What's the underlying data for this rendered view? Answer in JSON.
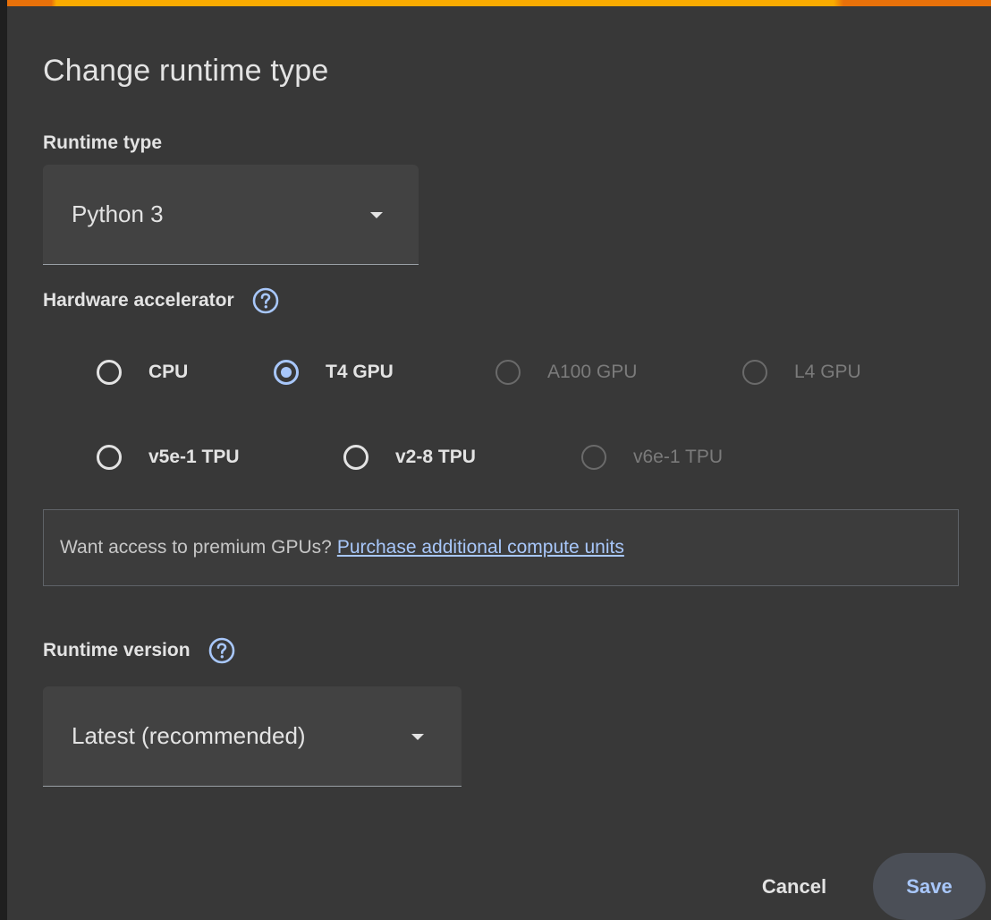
{
  "dialog": {
    "title": "Change runtime type",
    "accent_colors": [
      "#e8710a",
      "#f9ab00"
    ]
  },
  "runtime_type": {
    "label": "Runtime type",
    "selected": "Python 3"
  },
  "hardware": {
    "label": "Hardware accelerator",
    "selected": "T4 GPU",
    "options": [
      {
        "label": "CPU",
        "checked": false,
        "disabled": false
      },
      {
        "label": "T4 GPU",
        "checked": true,
        "disabled": false
      },
      {
        "label": "A100 GPU",
        "checked": false,
        "disabled": true
      },
      {
        "label": "L4 GPU",
        "checked": false,
        "disabled": true
      },
      {
        "label": "v5e-1 TPU",
        "checked": false,
        "disabled": false
      },
      {
        "label": "v2-8 TPU",
        "checked": false,
        "disabled": false
      },
      {
        "label": "v6e-1 TPU",
        "checked": false,
        "disabled": true
      }
    ]
  },
  "premium": {
    "text": "Want access to premium GPUs?",
    "link": "Purchase additional compute units"
  },
  "runtime_version": {
    "label": "Runtime version",
    "selected": "Latest (recommended)"
  },
  "actions": {
    "cancel": "Cancel",
    "save": "Save"
  },
  "icons": {
    "help": "help-circle-icon",
    "dropdown": "caret-down-icon"
  },
  "colors": {
    "background": "#383838",
    "text": "#e3e3e3",
    "accent": "#a8c7fa",
    "disabled": "#7b7b7b"
  }
}
